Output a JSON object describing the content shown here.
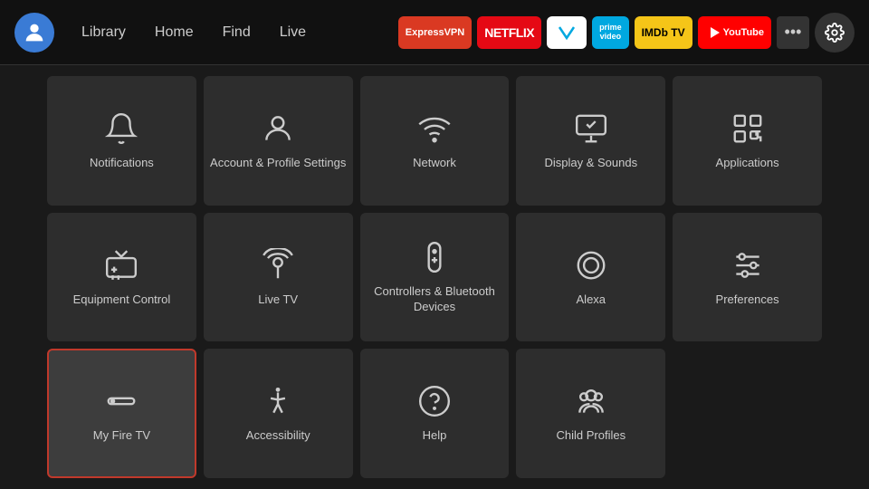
{
  "topbar": {
    "nav": [
      {
        "label": "Library",
        "id": "library"
      },
      {
        "label": "Home",
        "id": "home"
      },
      {
        "label": "Find",
        "id": "find"
      },
      {
        "label": "Live",
        "id": "live"
      }
    ],
    "apps": [
      {
        "label": "ExpressVPN",
        "bg": "#da3922",
        "color": "#fff",
        "id": "expressvpn"
      },
      {
        "label": "NETFLIX",
        "bg": "#e50914",
        "color": "#fff",
        "id": "netflix"
      },
      {
        "label": "↗",
        "bg": "#fff",
        "color": "#00a8e0",
        "id": "freevee"
      },
      {
        "label": "prime video",
        "bg": "#00a8e0",
        "color": "#fff",
        "id": "primevideo"
      },
      {
        "label": "IMDb TV",
        "bg": "#f5c518",
        "color": "#000",
        "id": "imdb"
      },
      {
        "label": "▶ YouTube",
        "bg": "#ff0000",
        "color": "#fff",
        "id": "youtube"
      }
    ],
    "more_label": "•••",
    "settings_icon": "gear-icon"
  },
  "grid": {
    "items": [
      {
        "id": "notifications",
        "label": "Notifications",
        "icon": "bell",
        "selected": false
      },
      {
        "id": "account-profile",
        "label": "Account & Profile Settings",
        "icon": "person",
        "selected": false
      },
      {
        "id": "network",
        "label": "Network",
        "icon": "wifi",
        "selected": false
      },
      {
        "id": "display-sounds",
        "label": "Display & Sounds",
        "icon": "display",
        "selected": false
      },
      {
        "id": "applications",
        "label": "Applications",
        "icon": "apps",
        "selected": false
      },
      {
        "id": "equipment-control",
        "label": "Equipment Control",
        "icon": "tv",
        "selected": false
      },
      {
        "id": "live-tv",
        "label": "Live TV",
        "icon": "antenna",
        "selected": false
      },
      {
        "id": "controllers-bluetooth",
        "label": "Controllers & Bluetooth Devices",
        "icon": "remote",
        "selected": false
      },
      {
        "id": "alexa",
        "label": "Alexa",
        "icon": "alexa",
        "selected": false
      },
      {
        "id": "preferences",
        "label": "Preferences",
        "icon": "sliders",
        "selected": false
      },
      {
        "id": "my-fire-tv",
        "label": "My Fire TV",
        "icon": "firetv",
        "selected": true
      },
      {
        "id": "accessibility",
        "label": "Accessibility",
        "icon": "accessibility",
        "selected": false
      },
      {
        "id": "help",
        "label": "Help",
        "icon": "help",
        "selected": false
      },
      {
        "id": "child-profiles",
        "label": "Child Profiles",
        "icon": "child",
        "selected": false
      }
    ]
  }
}
